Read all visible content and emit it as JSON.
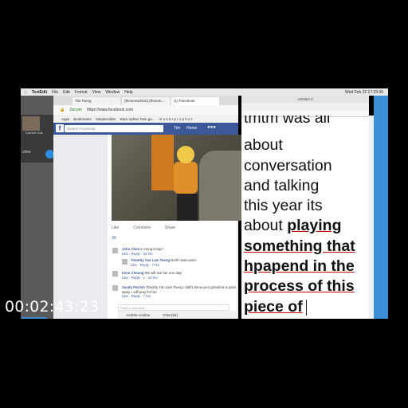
{
  "menubar": {
    "app": "TextEdit",
    "items": [
      "File",
      "Edit",
      "Format",
      "View",
      "Window",
      "Help"
    ],
    "clock": "Wed Feb 22  17:23:30"
  },
  "call": {
    "status": "Current Call",
    "partial": "ches"
  },
  "browser": {
    "tabs": [
      "Tim Tseng",
      "(thmemachine) (thmem...",
      "(1) Facebook"
    ],
    "secure": "Secure",
    "url": "https://www.facebook.com",
    "bookmarks": [
      "Apps",
      "Bookmarks",
      "SimpleAdder",
      "Rare Aphex Twin ge...",
      "m o n k • p r o p h e t"
    ]
  },
  "facebook": {
    "search_placeholder": "Search Facebook",
    "user": "Tim",
    "home": "Home",
    "actions": [
      "Like",
      "Comment",
      "Share"
    ],
    "reaction_count": "30",
    "comments": [
      {
        "name": "John Chen",
        "text": "in Hong Kong?",
        "meta": "Like · Reply · 33 hrs"
      },
      {
        "name": "Timothy Yan Lam Tseng",
        "text": "North Vancouver",
        "meta": "Like · Reply · 7 hrs"
      },
      {
        "name": "Irene Cheung",
        "text": "We will see her one day!",
        "meta": "Like · Reply · 1 · 16 hrs"
      },
      {
        "name": "Sandy Parrish",
        "text": "Timothy Yan Lam Tseng I didn't know your grandma is pass",
        "text2": "away. I will pray for her.",
        "meta": "Like · Reply · 7 hrs"
      }
    ],
    "write_placeholder": "Write a comment...",
    "chat": [
      "Andrée Azoline",
      "Chat (84)"
    ]
  },
  "textedit": {
    "title": "Untitled 3",
    "lines": [
      {
        "text": "tmtm was all",
        "bold": false,
        "cut": true
      },
      {
        "text": "about",
        "bold": false
      },
      {
        "text": "conversation",
        "bold": false
      },
      {
        "text": "and talking",
        "bold": false
      },
      {
        "text": "this year its",
        "bold": false
      },
      {
        "pre": "about ",
        "text": "playing",
        "bold": true
      },
      {
        "text": "something that",
        "bold": true
      },
      {
        "text": "hpapend in the",
        "bold": true
      },
      {
        "text": "process of this",
        "bold": true
      },
      {
        "text": "piece of",
        "bold": true,
        "cursor": true
      }
    ]
  },
  "timestamp": "00:02:43;23",
  "colors": {
    "facebook": "#3b5998",
    "desktop": "#3b8fd6",
    "accept": "#2d8ce0",
    "decline": "#e03030"
  }
}
